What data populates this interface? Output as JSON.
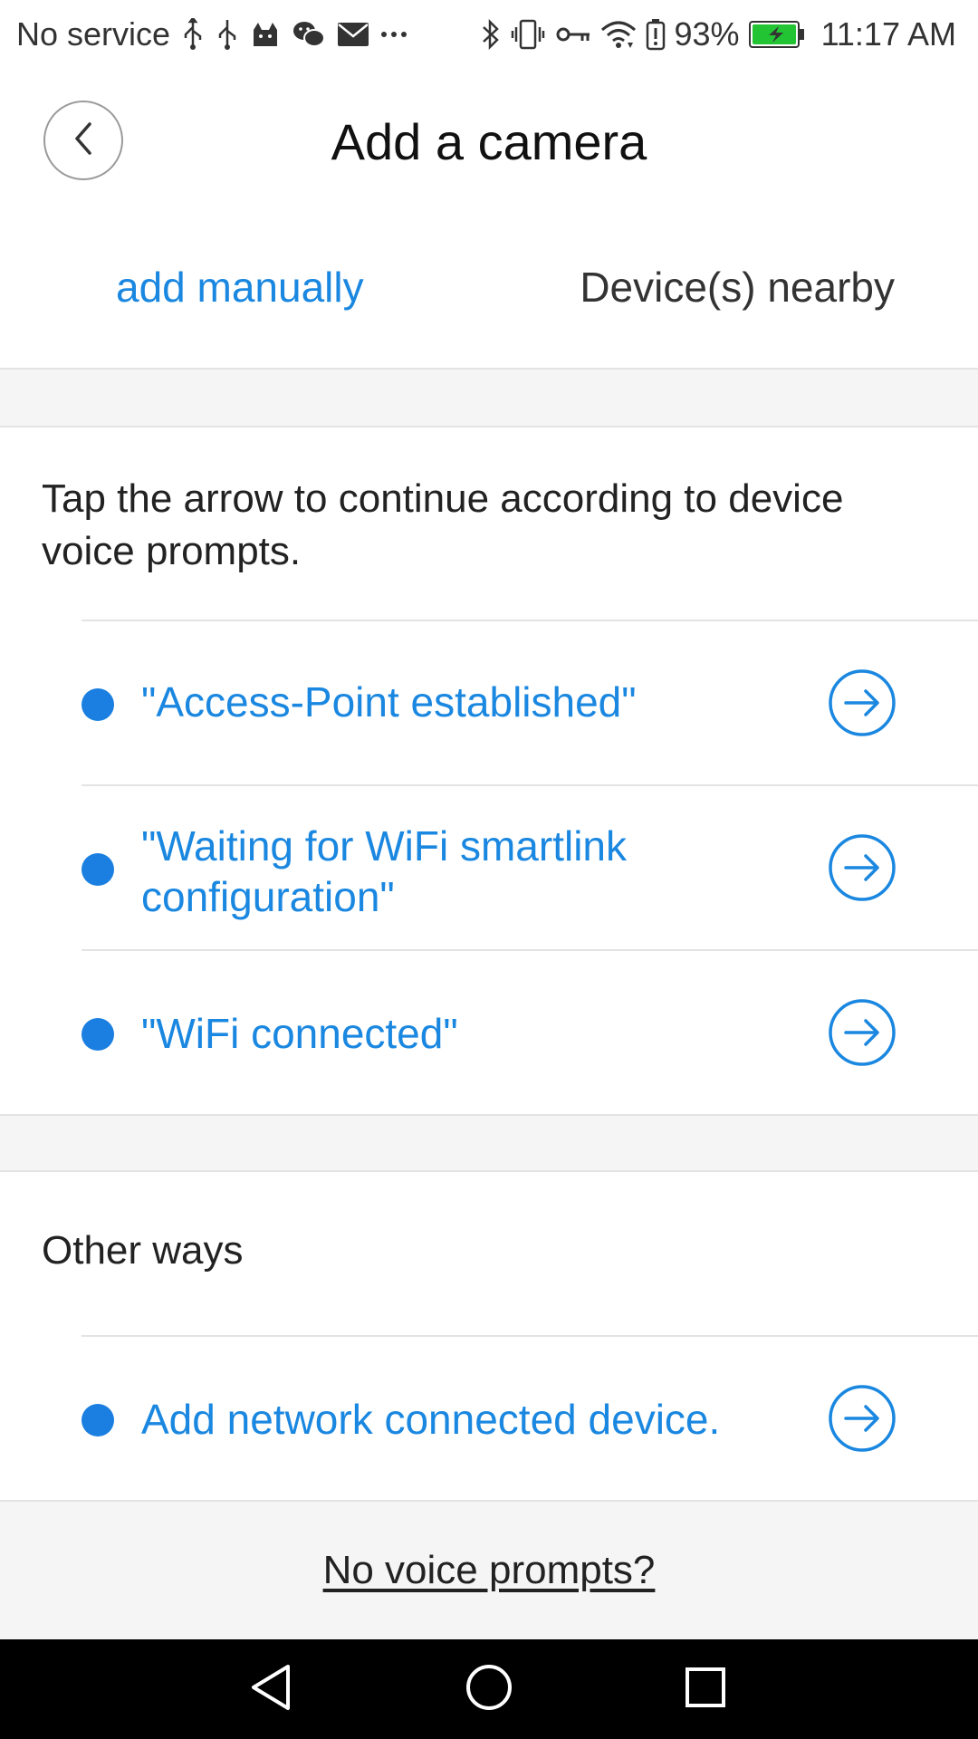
{
  "status_bar": {
    "carrier": "No service",
    "battery_percent": "93%",
    "time": "11:17 AM",
    "left_icons": [
      "usb-icon",
      "usb-icon",
      "cat-app-icon",
      "wechat-icon",
      "mail-icon",
      "more-icon"
    ],
    "right_icons": [
      "bluetooth-icon",
      "vibrate-icon",
      "vpn-key-icon",
      "wifi-icon",
      "battery-alert-icon",
      "battery-icon"
    ]
  },
  "header": {
    "title": "Add a camera",
    "back_icon": "chevron-left-icon"
  },
  "tabs": {
    "manual": "add manually",
    "nearby": "Device(s) nearby",
    "active": "manual"
  },
  "main": {
    "instruction": "Tap the arrow to continue according to device voice prompts.",
    "prompts": [
      {
        "label": "\"Access-Point established\""
      },
      {
        "label": "\"Waiting for WiFi smartlink configuration\""
      },
      {
        "label": "\"WiFi connected\""
      }
    ]
  },
  "other_ways": {
    "title": "Other ways",
    "items": [
      {
        "label": "Add network connected device."
      }
    ]
  },
  "footer": {
    "link": "No voice prompts?"
  },
  "colors": {
    "accent": "#1a87e0",
    "band": "#f5f5f5",
    "divider": "#e3e3e3"
  }
}
